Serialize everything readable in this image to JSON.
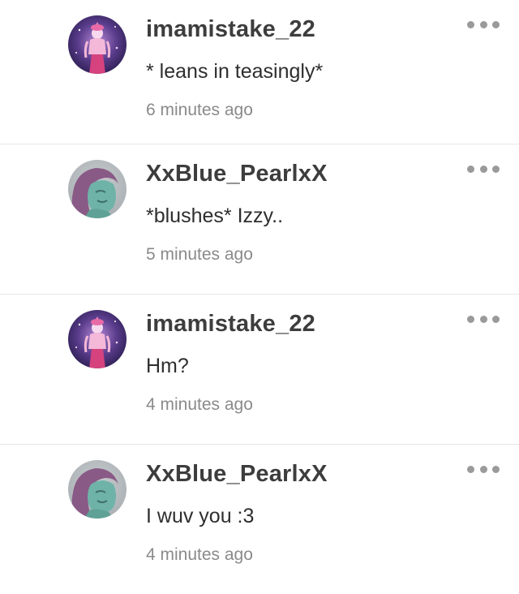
{
  "comments": [
    {
      "username": "imamistake_22",
      "message": "* leans in teasingly*",
      "timestamp": "6 minutes ago",
      "avatar_icon": "galaxy-character-avatar-icon"
    },
    {
      "username": "XxBlue_PearlxX",
      "message": "*blushes* Izzy..",
      "timestamp": "5 minutes ago",
      "avatar_icon": "blue-character-avatar-icon"
    },
    {
      "username": "imamistake_22",
      "message": "Hm?",
      "timestamp": "4 minutes ago",
      "avatar_icon": "galaxy-character-avatar-icon"
    },
    {
      "username": "XxBlue_PearlxX",
      "message": "I wuv you :3",
      "timestamp": "4 minutes ago",
      "avatar_icon": "blue-character-avatar-icon"
    }
  ],
  "colors": {
    "username": "#3d3d3d",
    "message": "#2e2e2e",
    "timestamp": "#8a8a8a",
    "more_dots": "#9a9a9a",
    "divider": "#e6e6e6"
  }
}
